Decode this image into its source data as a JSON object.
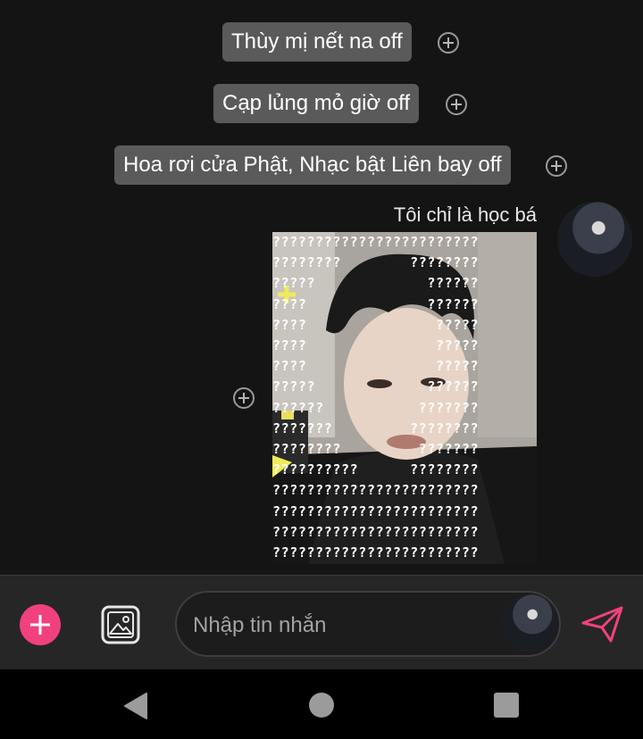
{
  "messages": [
    {
      "text": "Thùy mị nết na off"
    },
    {
      "text": "Cạp lủng mỏ giờ off"
    },
    {
      "text": "Hoa rơi cửa Phật, Nhạc bật Liên bay off"
    }
  ],
  "image_message": {
    "sender_name": "Tôi chỉ là học bá",
    "overlay_lines": [
      "????????????????????????",
      "????????        ????????",
      "?????             ??????",
      "????              ??????",
      "????               ?????",
      "????               ?????",
      "????               ?????",
      "?????             ??????",
      "??????           ???????",
      "???????         ????????",
      "????????         ???????",
      "??????????      ????????",
      "????????????????????????",
      "????????????????????????",
      "????????????????????????",
      "????????????????????????",
      "????????????????????????"
    ]
  },
  "composer": {
    "placeholder": "Nhập tin nhắn",
    "add_icon": "plus-icon",
    "gallery_icon": "image-icon",
    "send_icon": "send-icon",
    "accent_color": "#f0417e"
  },
  "nav": {
    "back_icon": "back-triangle-icon",
    "home_icon": "home-circle-icon",
    "recent_icon": "recent-square-icon"
  }
}
